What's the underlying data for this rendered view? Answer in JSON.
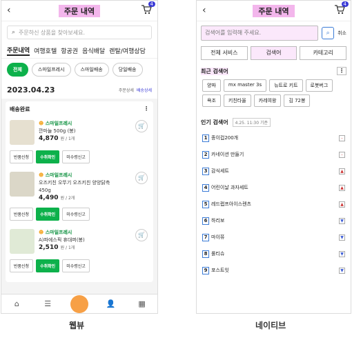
{
  "web": {
    "title": "주문 내역",
    "cart_badge": "4",
    "search_placeholder": "주문하신 상품을 찾아보세요.",
    "tabs": [
      "주문내역",
      "여행호텔",
      "항공권",
      "음식배달",
      "렌탈/여행상담"
    ],
    "chips": [
      "전체",
      "스마일프레시",
      "스마일배송",
      "당일배송"
    ],
    "date": "2023.04.23",
    "order_detail": "주문상세",
    "delivery_detail": "배송상세",
    "status": "배송완료",
    "items": [
      {
        "seller": "스마일프레시",
        "name": "깐마늘 500g (봉)",
        "price": "4,870",
        "qty": "원 / 1개"
      },
      {
        "seller": "스마일프레시",
        "name": "오즈키친 오뚜기 오즈키친 양양닭측 450g",
        "price": "4,490",
        "qty": "원 / 2개"
      },
      {
        "seller": "스마일프레시",
        "name": "A)파에스픽 휴대퍼(봉)",
        "price": "2,510",
        "qty": "원 / 1개"
      }
    ],
    "buttons": [
      "반품신청",
      "수취확인",
      "미수령신고"
    ],
    "caption": "웹뷰"
  },
  "native": {
    "title": "주문 내역",
    "cart_badge": "4",
    "search_placeholder": "검색어를 입력해 주세요.",
    "cancel": "취소",
    "tabs": [
      "전체 서비스",
      "검색어",
      "카테고리"
    ],
    "recent_title": "최근 검색어",
    "recent": [
      "양파",
      "mx master 3s",
      "뉴트로 키트",
      "로봇버그",
      "욕조",
      "키친타올",
      "카레여왕",
      "김 72봉"
    ],
    "popular_title": "인기 검색어",
    "popular_time": "4.25. 11:30 기준",
    "popular": [
      {
        "rank": "1",
        "term": "종이컵200개",
        "trend": "-"
      },
      {
        "rank": "2",
        "term": "카네이션 만들기",
        "trend": "-"
      },
      {
        "rank": "3",
        "term": "감식세트",
        "trend": "▲"
      },
      {
        "rank": "4",
        "term": "어린이날 과자세트",
        "trend": "▲"
      },
      {
        "rank": "5",
        "term": "레드랩프아이스렌츠",
        "trend": "▲"
      },
      {
        "rank": "6",
        "term": "하리보",
        "trend": "▼"
      },
      {
        "rank": "7",
        "term": "마이쮸",
        "trend": "▼"
      },
      {
        "rank": "8",
        "term": "롤티슈",
        "trend": "▼"
      },
      {
        "rank": "9",
        "term": "포스트잇",
        "trend": "▼"
      }
    ],
    "caption": "네이티브"
  },
  "colors": {
    "accent": "#0db14b",
    "highlight": "#f3b6ec",
    "badge": "#3b3bd6"
  }
}
